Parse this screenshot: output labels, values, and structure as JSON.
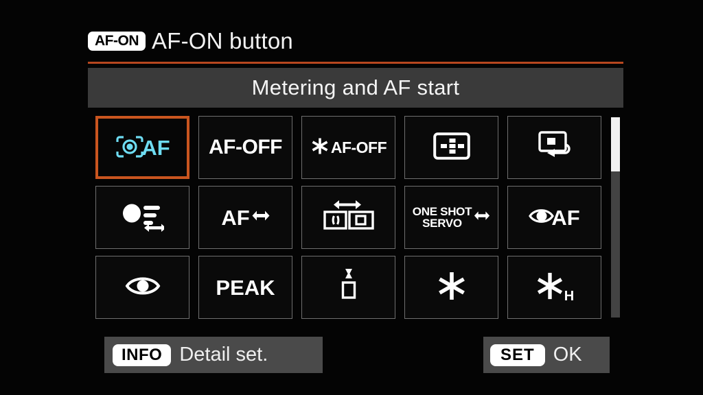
{
  "header": {
    "button_badge": "AF-ON",
    "title": "AF-ON button",
    "accent_color": "#b8471f"
  },
  "subtitle": {
    "text": "Metering and AF start"
  },
  "grid": {
    "columns": 5,
    "rows": 3,
    "selected_index": 0,
    "selection_color": "#c9551f",
    "selected_icon_color": "#6edcf2",
    "items": [
      {
        "index": 0,
        "name": "metering-and-af-start",
        "icon": "camera-metering-af-icon",
        "label": "AF",
        "selected": true
      },
      {
        "index": 1,
        "name": "af-off",
        "icon": "text-only",
        "label": "AF-OFF",
        "selected": false
      },
      {
        "index": 2,
        "name": "ae-lock-af-off",
        "icon": "asterisk-icon",
        "label": "AF-OFF",
        "selected": false
      },
      {
        "index": 3,
        "name": "af-point-selection",
        "icon": "af-point-grid-icon",
        "label": "",
        "selected": false
      },
      {
        "index": 4,
        "name": "switch-to-registered-af-func",
        "icon": "registered-af-point-icon",
        "label": "",
        "selected": false
      },
      {
        "index": 5,
        "name": "subject-to-detect-switch",
        "icon": "subject-detect-icon",
        "label": "",
        "selected": false
      },
      {
        "index": 6,
        "name": "af-method-switch",
        "icon": "double-arrow-icon",
        "label": "AF",
        "selected": false
      },
      {
        "index": 7,
        "name": "af-area-switch",
        "icon": "af-area-switch-icon",
        "label": "",
        "selected": false
      },
      {
        "index": 8,
        "name": "one-shot-servo-switch",
        "icon": "double-arrow-icon",
        "label": "ONE SHOT\nSERVO",
        "selected": false
      },
      {
        "index": 9,
        "name": "eye-detection-af",
        "icon": "eye-af-icon",
        "label": "AF",
        "selected": false
      },
      {
        "index": 10,
        "name": "eye-detection",
        "icon": "eye-icon",
        "label": "",
        "selected": false
      },
      {
        "index": 11,
        "name": "focus-peaking",
        "icon": "text-only",
        "label": "PEAK",
        "selected": false
      },
      {
        "index": 12,
        "name": "depth-of-field-preview",
        "icon": "aperture-preview-icon",
        "label": "",
        "selected": false
      },
      {
        "index": 13,
        "name": "ae-lock",
        "icon": "asterisk-icon",
        "label": "",
        "selected": false
      },
      {
        "index": 14,
        "name": "ae-lock-hold",
        "icon": "asterisk-icon",
        "label": "H",
        "selected": false
      }
    ]
  },
  "scrollbar": {
    "thumb_position_percent": 0,
    "thumb_size_percent": 27
  },
  "footer": {
    "info_badge": "INFO",
    "info_label": "Detail set.",
    "set_badge": "SET",
    "set_label": "OK"
  }
}
